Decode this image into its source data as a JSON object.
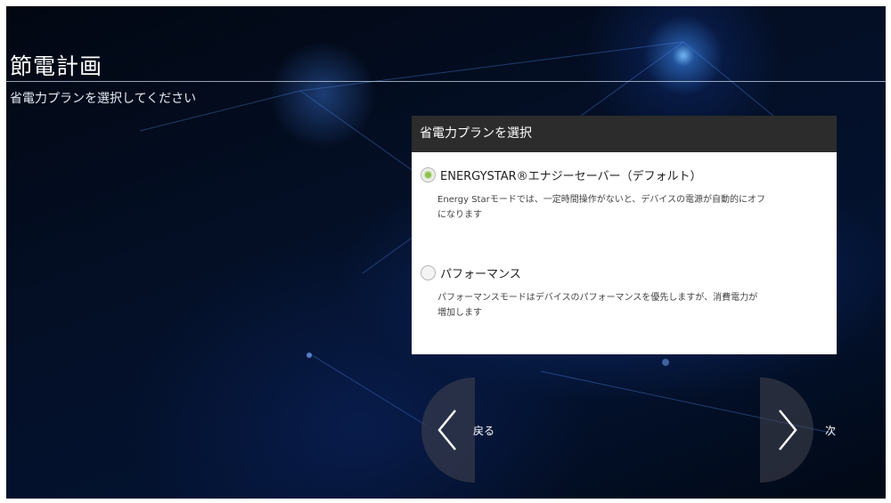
{
  "header": {
    "title": "節電計画",
    "subtitle": "省電力プランを選択してください"
  },
  "dialog": {
    "title": "省電力プランを選択",
    "options": [
      {
        "label": "ENERGYSTAR®エナジーセーバー（デフォルト）",
        "description_line1": "Energy Starモードでは、一定時間操作がないと、デバイスの電源が自動的にオフ",
        "description_line2": "になります",
        "selected": true
      },
      {
        "label": "パフォーマンス",
        "description_line1": "パフォーマンスモードはデバイスのパフォーマンスを優先しますが、消費電力が",
        "description_line2": "増加します",
        "selected": false
      }
    ]
  },
  "navigation": {
    "back_label": "戻る",
    "next_label": "次",
    "back_icon": "chevron-left-icon",
    "next_icon": "chevron-right-icon"
  },
  "colors": {
    "accent": "#8bc34a",
    "dialog_header": "#2c2c2c",
    "background": "#03122f"
  }
}
